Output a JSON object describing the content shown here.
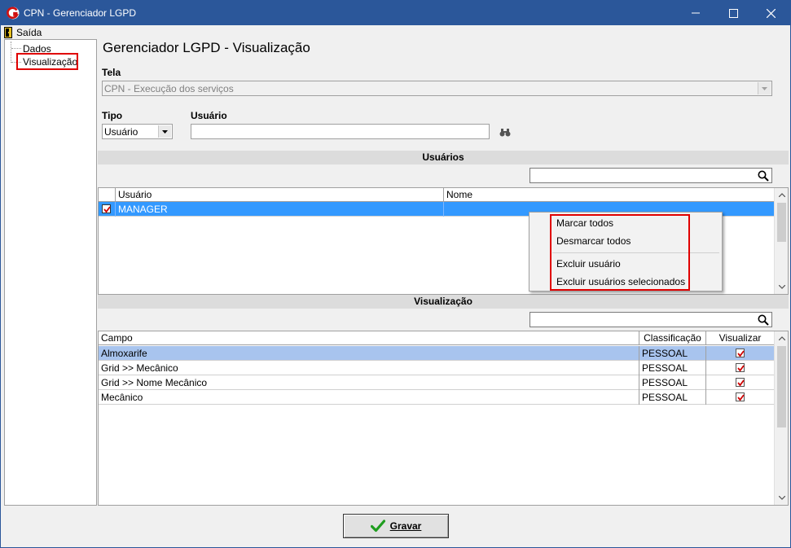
{
  "window": {
    "title": "CPN - Gerenciador LGPD",
    "colors": {
      "titlebar": "#2b579a",
      "highlight": "#e00000",
      "selected_row": "#3399ff",
      "selected_row_alt": "#a8c4ee"
    }
  },
  "menu": {
    "saida_label": "Saída"
  },
  "tree": {
    "items": [
      {
        "label": "Dados"
      },
      {
        "label": "Visualização"
      }
    ]
  },
  "main": {
    "title": "Gerenciador LGPD - Visualização",
    "tela": {
      "label": "Tela",
      "value": "CPN - Execução dos serviços"
    },
    "tipo": {
      "label": "Tipo",
      "value": "Usuário"
    },
    "usuario": {
      "label": "Usuário",
      "value": ""
    }
  },
  "usuarios_section": {
    "title": "Usuários",
    "search_value": "",
    "columns": [
      "Usuário",
      "Nome"
    ],
    "rows": [
      {
        "checked": true,
        "usuario": "MANAGER",
        "nome": ""
      }
    ]
  },
  "context_menu": {
    "items": [
      "Marcar todos",
      "Desmarcar todos",
      "Excluir usuário",
      "Excluir usuários selecionados"
    ]
  },
  "visualizacao_section": {
    "title": "Visualização",
    "search_value": "",
    "columns": [
      "Campo",
      "Classificação",
      "Visualizar"
    ],
    "rows": [
      {
        "campo": "Almoxarife",
        "classificacao": "PESSOAL",
        "visualizar": true
      },
      {
        "campo": "Grid >> Mecânico",
        "classificacao": "PESSOAL",
        "visualizar": true
      },
      {
        "campo": "Grid >> Nome Mecânico",
        "classificacao": "PESSOAL",
        "visualizar": true
      },
      {
        "campo": "Mecânico",
        "classificacao": "PESSOAL",
        "visualizar": true
      }
    ]
  },
  "footer": {
    "save_label": "Gravar"
  }
}
